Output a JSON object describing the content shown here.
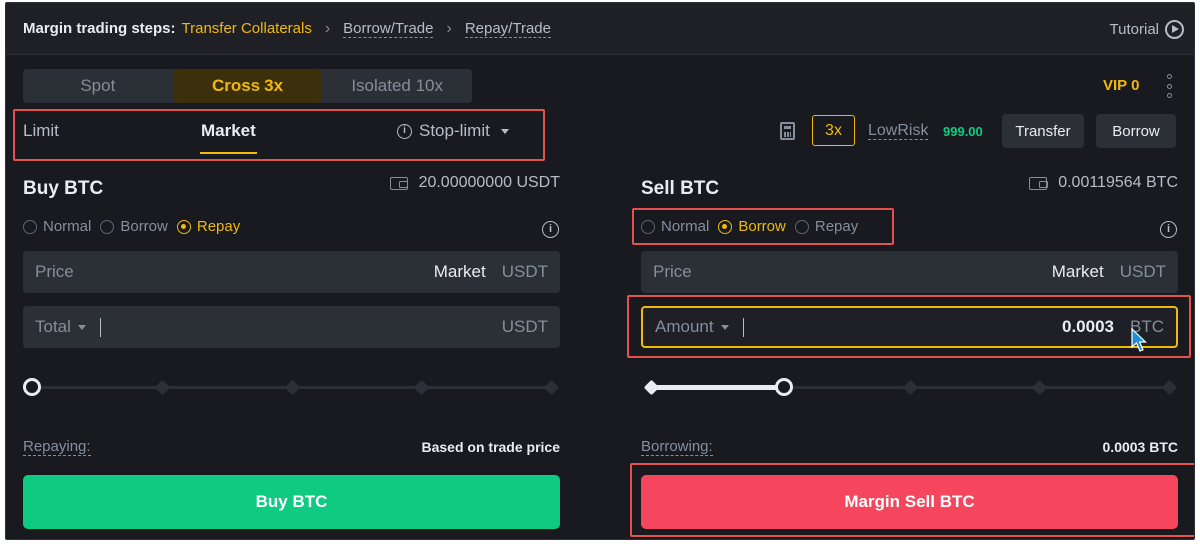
{
  "steps": {
    "label": "Margin trading steps:",
    "items": [
      "Transfer Collaterals",
      "Borrow/Trade",
      "Repay/Trade"
    ],
    "tutorial": "Tutorial"
  },
  "modes": {
    "spot": "Spot",
    "cross": "Cross",
    "cross_lev": "3x",
    "isolated": "Isolated 10x"
  },
  "vip": "VIP 0",
  "order_tabs": {
    "limit": "Limit",
    "market": "Market",
    "stop_limit": "Stop-limit"
  },
  "toolbar": {
    "leverage": "3x",
    "risk_label": "LowRisk",
    "risk_value": "999.00",
    "transfer": "Transfer",
    "borrow": "Borrow"
  },
  "buy": {
    "title": "Buy BTC",
    "available": "20.00000000 USDT",
    "radios": [
      "Normal",
      "Borrow",
      "Repay"
    ],
    "selected_radio": "Repay",
    "price_label": "Price",
    "price_value": "Market",
    "price_unit": "USDT",
    "total_label": "Total",
    "total_unit": "USDT",
    "slider_percent": 0,
    "info_label": "Repaying:",
    "info_value": "Based on trade price",
    "button": "Buy BTC"
  },
  "sell": {
    "title": "Sell BTC",
    "available": "0.00119564 BTC",
    "radios": [
      "Normal",
      "Borrow",
      "Repay"
    ],
    "selected_radio": "Borrow",
    "price_label": "Price",
    "price_value": "Market",
    "price_unit": "USDT",
    "amount_label": "Amount",
    "amount_value": "0.0003",
    "amount_unit": "BTC",
    "slider_percent": 25,
    "info_label": "Borrowing:",
    "info_value": "0.0003 BTC",
    "button": "Margin Sell BTC"
  },
  "colors": {
    "accent": "#f0b90b",
    "buy": "#0ecb81",
    "sell": "#f6465d",
    "highlight": "#e5514f",
    "background": "#181a20"
  }
}
